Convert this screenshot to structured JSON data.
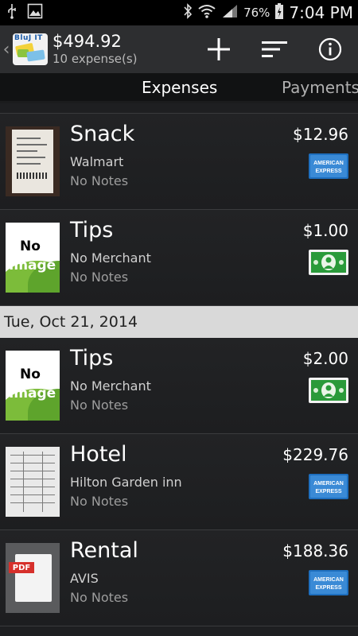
{
  "statusbar": {
    "battery": "76%",
    "time": "7:04 PM"
  },
  "actionbar": {
    "icon_brand": "BluJ IT",
    "total": "$494.92",
    "subtitle": "10 expense(s)"
  },
  "tabs": [
    "Expenses",
    "Payments"
  ],
  "list": {
    "rows_before": [
      {
        "title": "Snack",
        "merchant": "Walmart",
        "notes": "No Notes",
        "amount": "$12.96",
        "payment": "amex",
        "thumb": "receipt"
      },
      {
        "title": "Tips",
        "merchant": "No Merchant",
        "notes": "No Notes",
        "amount": "$1.00",
        "payment": "cash",
        "thumb": "noimage"
      }
    ],
    "section_header": "Tue, Oct 21, 2014",
    "rows_after": [
      {
        "title": "Tips",
        "merchant": "No Merchant",
        "notes": "No Notes",
        "amount": "$2.00",
        "payment": "cash",
        "thumb": "noimage"
      },
      {
        "title": "Hotel",
        "merchant": "Hilton Garden inn",
        "notes": "No Notes",
        "amount": "$229.76",
        "payment": "amex",
        "thumb": "doc"
      },
      {
        "title": "Rental",
        "merchant": "AVIS",
        "notes": "No Notes",
        "amount": "$188.36",
        "payment": "amex",
        "thumb": "pdf"
      }
    ]
  },
  "thumb_labels": {
    "no": "No",
    "image": "Image",
    "pdf": "PDF"
  },
  "payment_labels": {
    "amex_line1": "AMERICAN",
    "amex_line2": "EXPRESS"
  },
  "colors": {
    "amex_blue": "#1e6fbf",
    "cash_green": "#2a9a3a",
    "section_bg": "#d9d9d9"
  }
}
